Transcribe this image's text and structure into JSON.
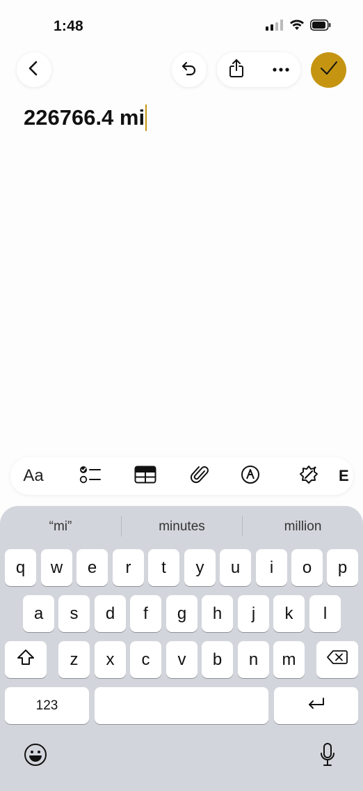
{
  "status_bar": {
    "time": "1:48"
  },
  "note": {
    "text": "226766.4 mi"
  },
  "toolbar": {
    "format_label": "Aa"
  },
  "suggestions": [
    "“mi”",
    "minutes",
    "million"
  ],
  "keyboard": {
    "row1": [
      "q",
      "w",
      "e",
      "r",
      "t",
      "y",
      "u",
      "i",
      "o",
      "p"
    ],
    "row2": [
      "a",
      "s",
      "d",
      "f",
      "g",
      "h",
      "j",
      "k",
      "l"
    ],
    "row3": [
      "z",
      "x",
      "c",
      "v",
      "b",
      "n",
      "m"
    ],
    "numbers_label": "123"
  },
  "colors": {
    "accent": "#c59512",
    "keyboard_bg": "#d3d5dc"
  }
}
